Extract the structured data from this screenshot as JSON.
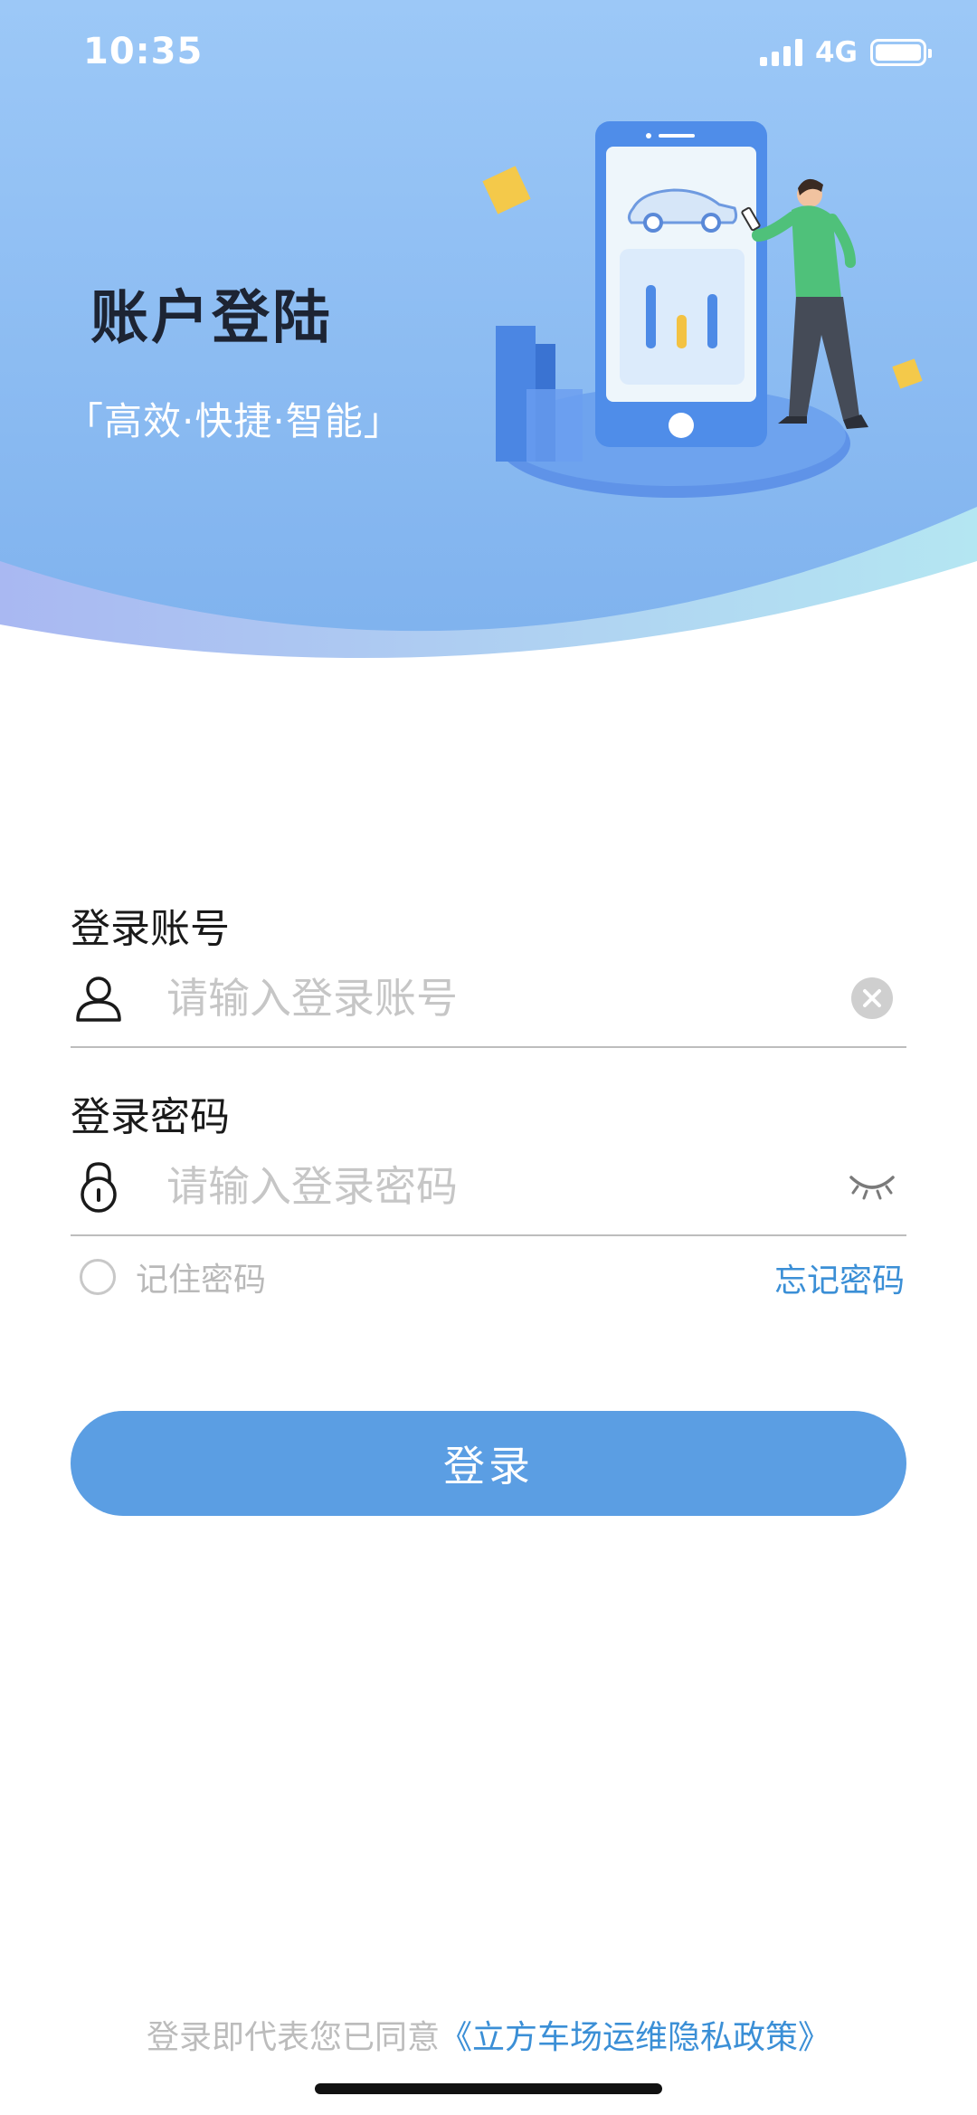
{
  "status_bar": {
    "time": "10:35",
    "network": "4G"
  },
  "hero": {
    "title": "账户登陆",
    "subtitle": "「高效·快捷·智能」"
  },
  "form": {
    "account": {
      "label": "登录账号",
      "placeholder": "请输入登录账号",
      "value": ""
    },
    "password": {
      "label": "登录密码",
      "placeholder": "请输入登录密码",
      "value": ""
    },
    "remember_label": "记住密码",
    "remember_checked": false,
    "forgot_label": "忘记密码",
    "login_label": "登录"
  },
  "agreement": {
    "prefix": "登录即代表您已同意",
    "policy": "《立方车场运维隐私政策》"
  },
  "colors": {
    "accent": "#5b9ee3",
    "link": "#3b8fd6",
    "hero_bg": "#8dc0f5",
    "title": "#1d2433"
  },
  "icons": [
    "user-icon",
    "lock-icon",
    "clear-icon",
    "eye-closed-icon",
    "signal-icon",
    "battery-icon"
  ]
}
